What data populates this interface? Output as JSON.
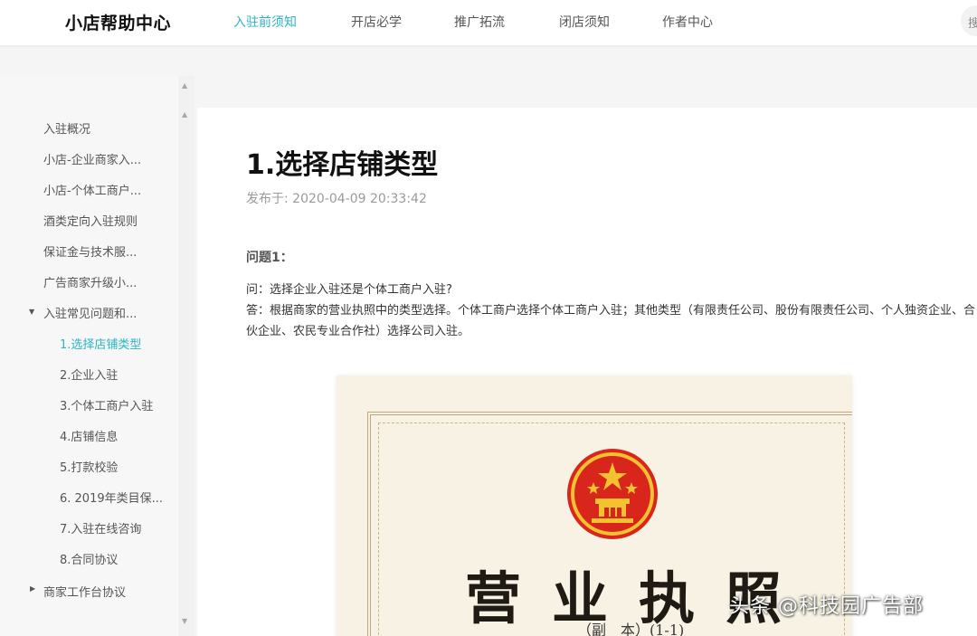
{
  "brand": "小店帮助中心",
  "nav": {
    "items": [
      {
        "label": "入驻前须知",
        "active": true
      },
      {
        "label": "开店必学",
        "active": false
      },
      {
        "label": "推广拓流",
        "active": false
      },
      {
        "label": "闭店须知",
        "active": false
      },
      {
        "label": "作者中心",
        "active": false
      }
    ],
    "search_partial": "搜"
  },
  "sidebar": {
    "items": [
      {
        "label": "入驻概况"
      },
      {
        "label": "小店-企业商家入..."
      },
      {
        "label": "小店-个体工商户..."
      },
      {
        "label": "酒类定向入驻规则"
      },
      {
        "label": "保证金与技术服..."
      },
      {
        "label": "广告商家升级小..."
      },
      {
        "label": "入驻常见问题和...",
        "expanded": true
      },
      {
        "label": "1.选择店铺类型",
        "active": true
      },
      {
        "label": "2.企业入驻"
      },
      {
        "label": "3.个体工商户入驻"
      },
      {
        "label": "4.店铺信息"
      },
      {
        "label": "5.打款校验"
      },
      {
        "label": "6. 2019年类目保..."
      },
      {
        "label": "7.入驻在线咨询"
      },
      {
        "label": "8.合同协议"
      },
      {
        "label": "商家工作台协议",
        "expanded": false
      }
    ]
  },
  "article": {
    "title": "1.选择店铺类型",
    "published": "发布于: 2020-04-09 20:33:42",
    "question_heading": "问题1：",
    "question": "问：选择企业入驻还是个体工商户入驻?",
    "answer": "答：根据商家的营业执照中的类型选择。个体工商户选择个体工商户入驻；其他类型（有限责任公司、股份有限责任公司、个人独资企业、合伙企业、农民专业合作社）选择公司入驻。"
  },
  "license_image": {
    "title": "营业执照",
    "subtitle": "（副　本）(1-1)"
  },
  "watermark": "头条 @科技园广告部",
  "colors": {
    "accent": "#2bb5c6",
    "emblem_red": "#d8261c",
    "emblem_gold": "#f2c230"
  }
}
